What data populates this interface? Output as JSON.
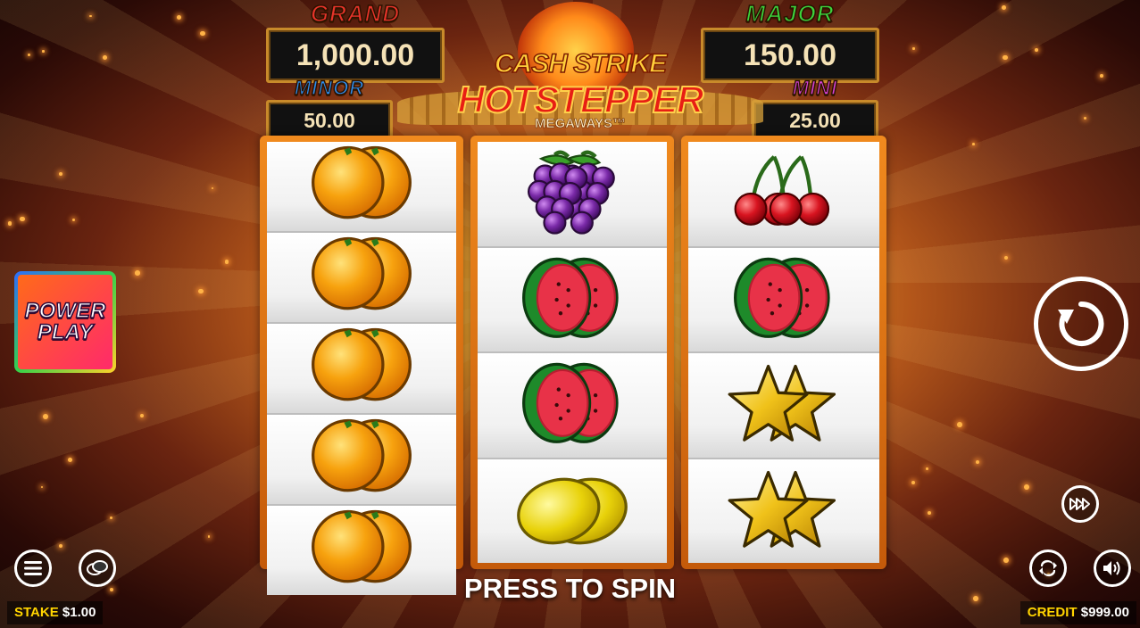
{
  "jackpots": {
    "grand": {
      "label": "GRAND",
      "value": "1,000.00"
    },
    "major": {
      "label": "MAJOR",
      "value": "150.00"
    },
    "minor": {
      "label": "MINOR",
      "value": "50.00"
    },
    "mini": {
      "label": "MINI",
      "value": "25.00"
    }
  },
  "logo": {
    "line1": "CASH STRIKE",
    "line2": "HOTSTEPPER",
    "line3": "MEGAWAYS™"
  },
  "reels": [
    [
      "orange",
      "orange",
      "orange",
      "orange",
      "orange"
    ],
    [
      "grapes",
      "watermelon",
      "watermelon",
      "lemon"
    ],
    [
      "cherry",
      "watermelon",
      "star",
      "star"
    ]
  ],
  "power_play": {
    "line1": "POWER",
    "line2": "PLAY"
  },
  "press_to_spin": "PRESS TO SPIN",
  "footer": {
    "stake_label": "STAKE",
    "stake_value": "$1.00",
    "credit_label": "CREDIT",
    "credit_value": "$999.00"
  },
  "icons": {
    "spin": "spin-icon",
    "turbo": "fast-forward-icon",
    "menu": "menu-icon",
    "bet": "coins-icon",
    "autoplay": "autoplay-icon",
    "sound": "speaker-icon"
  },
  "colors": {
    "grand": "#e8342a",
    "major": "#3cd43c",
    "minor": "#2d8ff0",
    "mini": "#d642d6",
    "accent": "#ffd400"
  }
}
